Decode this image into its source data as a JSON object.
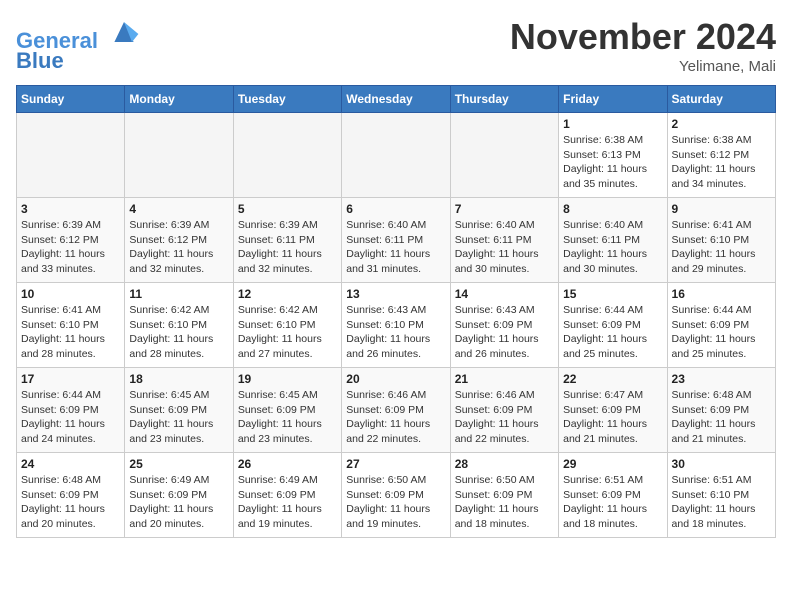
{
  "header": {
    "logo_line1": "General",
    "logo_line2": "Blue",
    "month": "November 2024",
    "location": "Yelimane, Mali"
  },
  "days_of_week": [
    "Sunday",
    "Monday",
    "Tuesday",
    "Wednesday",
    "Thursday",
    "Friday",
    "Saturday"
  ],
  "weeks": [
    [
      {
        "day": "",
        "info": ""
      },
      {
        "day": "",
        "info": ""
      },
      {
        "day": "",
        "info": ""
      },
      {
        "day": "",
        "info": ""
      },
      {
        "day": "",
        "info": ""
      },
      {
        "day": "1",
        "info": "Sunrise: 6:38 AM\nSunset: 6:13 PM\nDaylight: 11 hours and 35 minutes."
      },
      {
        "day": "2",
        "info": "Sunrise: 6:38 AM\nSunset: 6:12 PM\nDaylight: 11 hours and 34 minutes."
      }
    ],
    [
      {
        "day": "3",
        "info": "Sunrise: 6:39 AM\nSunset: 6:12 PM\nDaylight: 11 hours and 33 minutes."
      },
      {
        "day": "4",
        "info": "Sunrise: 6:39 AM\nSunset: 6:12 PM\nDaylight: 11 hours and 32 minutes."
      },
      {
        "day": "5",
        "info": "Sunrise: 6:39 AM\nSunset: 6:11 PM\nDaylight: 11 hours and 32 minutes."
      },
      {
        "day": "6",
        "info": "Sunrise: 6:40 AM\nSunset: 6:11 PM\nDaylight: 11 hours and 31 minutes."
      },
      {
        "day": "7",
        "info": "Sunrise: 6:40 AM\nSunset: 6:11 PM\nDaylight: 11 hours and 30 minutes."
      },
      {
        "day": "8",
        "info": "Sunrise: 6:40 AM\nSunset: 6:11 PM\nDaylight: 11 hours and 30 minutes."
      },
      {
        "day": "9",
        "info": "Sunrise: 6:41 AM\nSunset: 6:10 PM\nDaylight: 11 hours and 29 minutes."
      }
    ],
    [
      {
        "day": "10",
        "info": "Sunrise: 6:41 AM\nSunset: 6:10 PM\nDaylight: 11 hours and 28 minutes."
      },
      {
        "day": "11",
        "info": "Sunrise: 6:42 AM\nSunset: 6:10 PM\nDaylight: 11 hours and 28 minutes."
      },
      {
        "day": "12",
        "info": "Sunrise: 6:42 AM\nSunset: 6:10 PM\nDaylight: 11 hours and 27 minutes."
      },
      {
        "day": "13",
        "info": "Sunrise: 6:43 AM\nSunset: 6:10 PM\nDaylight: 11 hours and 26 minutes."
      },
      {
        "day": "14",
        "info": "Sunrise: 6:43 AM\nSunset: 6:09 PM\nDaylight: 11 hours and 26 minutes."
      },
      {
        "day": "15",
        "info": "Sunrise: 6:44 AM\nSunset: 6:09 PM\nDaylight: 11 hours and 25 minutes."
      },
      {
        "day": "16",
        "info": "Sunrise: 6:44 AM\nSunset: 6:09 PM\nDaylight: 11 hours and 25 minutes."
      }
    ],
    [
      {
        "day": "17",
        "info": "Sunrise: 6:44 AM\nSunset: 6:09 PM\nDaylight: 11 hours and 24 minutes."
      },
      {
        "day": "18",
        "info": "Sunrise: 6:45 AM\nSunset: 6:09 PM\nDaylight: 11 hours and 23 minutes."
      },
      {
        "day": "19",
        "info": "Sunrise: 6:45 AM\nSunset: 6:09 PM\nDaylight: 11 hours and 23 minutes."
      },
      {
        "day": "20",
        "info": "Sunrise: 6:46 AM\nSunset: 6:09 PM\nDaylight: 11 hours and 22 minutes."
      },
      {
        "day": "21",
        "info": "Sunrise: 6:46 AM\nSunset: 6:09 PM\nDaylight: 11 hours and 22 minutes."
      },
      {
        "day": "22",
        "info": "Sunrise: 6:47 AM\nSunset: 6:09 PM\nDaylight: 11 hours and 21 minutes."
      },
      {
        "day": "23",
        "info": "Sunrise: 6:48 AM\nSunset: 6:09 PM\nDaylight: 11 hours and 21 minutes."
      }
    ],
    [
      {
        "day": "24",
        "info": "Sunrise: 6:48 AM\nSunset: 6:09 PM\nDaylight: 11 hours and 20 minutes."
      },
      {
        "day": "25",
        "info": "Sunrise: 6:49 AM\nSunset: 6:09 PM\nDaylight: 11 hours and 20 minutes."
      },
      {
        "day": "26",
        "info": "Sunrise: 6:49 AM\nSunset: 6:09 PM\nDaylight: 11 hours and 19 minutes."
      },
      {
        "day": "27",
        "info": "Sunrise: 6:50 AM\nSunset: 6:09 PM\nDaylight: 11 hours and 19 minutes."
      },
      {
        "day": "28",
        "info": "Sunrise: 6:50 AM\nSunset: 6:09 PM\nDaylight: 11 hours and 18 minutes."
      },
      {
        "day": "29",
        "info": "Sunrise: 6:51 AM\nSunset: 6:09 PM\nDaylight: 11 hours and 18 minutes."
      },
      {
        "day": "30",
        "info": "Sunrise: 6:51 AM\nSunset: 6:10 PM\nDaylight: 11 hours and 18 minutes."
      }
    ]
  ]
}
